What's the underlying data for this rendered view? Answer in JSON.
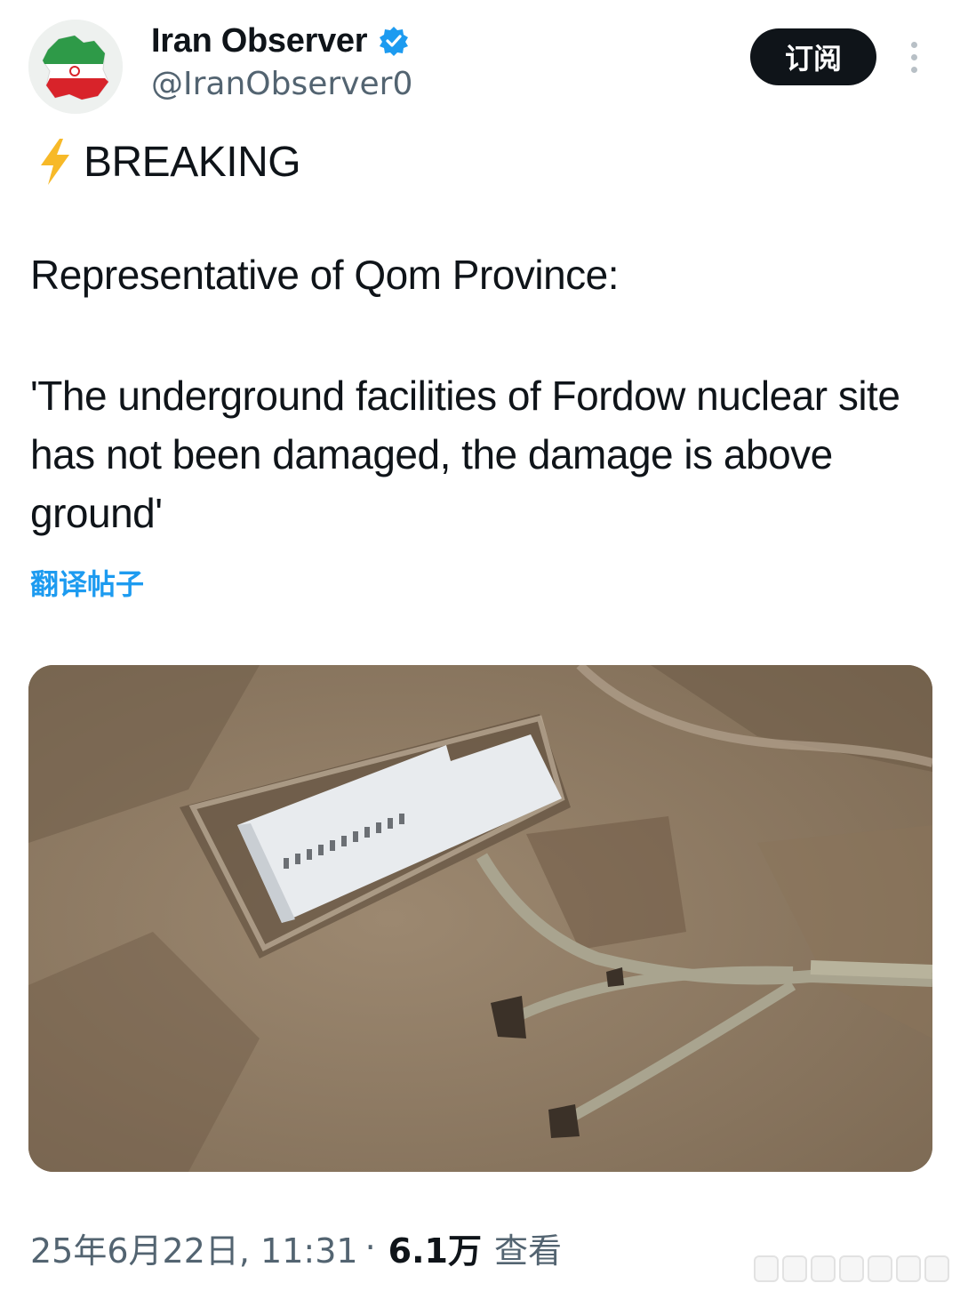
{
  "author": {
    "display_name": "Iran Observer",
    "handle": "@IranObserver0"
  },
  "actions": {
    "subscribe_label": "订阅"
  },
  "post": {
    "breaking_label": "BREAKING",
    "line_1": "Representative of Qom Province:",
    "quote": "'The underground facilities of Fordow nuclear site has not been damaged, the damage is above ground'",
    "translate_label": "翻译帖子"
  },
  "meta": {
    "date_time": "25年6月22日, 11:31",
    "separator": "·",
    "views_count": "6.1万",
    "views_label": "查看"
  },
  "icons": {
    "verified": "verified-badge-icon",
    "more": "more-vertical-icon",
    "breaking": "lightning-bolt-icon"
  },
  "colors": {
    "accent": "#1d9bf0",
    "text_primary": "#0f1419",
    "text_secondary": "#536471",
    "button_bg": "#0f1419"
  }
}
